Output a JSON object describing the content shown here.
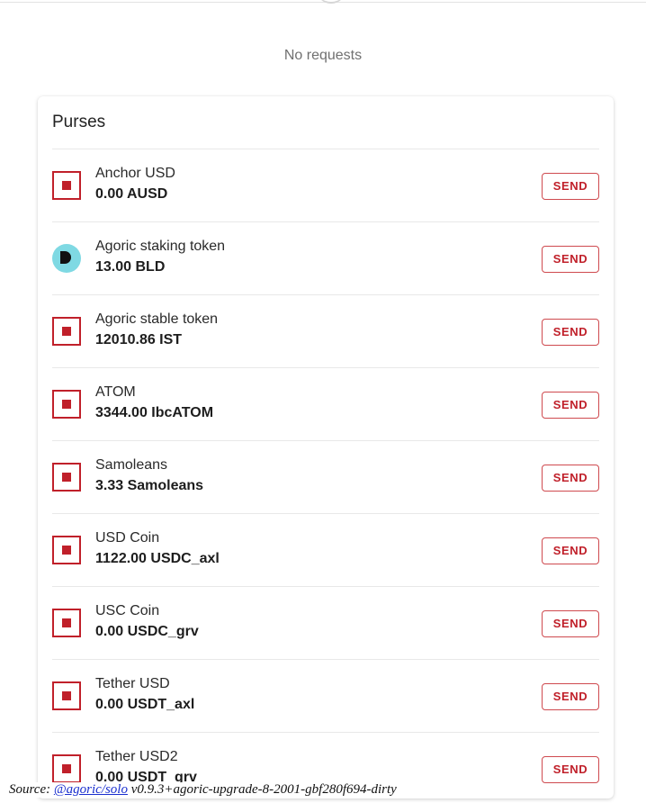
{
  "requests": {
    "empty_text": "No requests"
  },
  "purses": {
    "title": "Purses",
    "items": [
      {
        "name": "Anchor USD",
        "balance": "0.00 AUSD",
        "icon": "square-icon",
        "send_label": "SEND"
      },
      {
        "name": "Agoric staking token",
        "balance": "13.00 BLD",
        "icon": "bld-logo-icon",
        "send_label": "SEND"
      },
      {
        "name": "Agoric stable token",
        "balance": "12010.86 IST",
        "icon": "square-icon",
        "send_label": "SEND"
      },
      {
        "name": "ATOM",
        "balance": "3344.00 IbcATOM",
        "icon": "square-icon",
        "send_label": "SEND"
      },
      {
        "name": "Samoleans",
        "balance": "3.33 Samoleans",
        "icon": "square-icon",
        "send_label": "SEND"
      },
      {
        "name": "USD Coin",
        "balance": "1122.00 USDC_axl",
        "icon": "square-icon",
        "send_label": "SEND"
      },
      {
        "name": "USC Coin",
        "balance": "0.00 USDC_grv",
        "icon": "square-icon",
        "send_label": "SEND"
      },
      {
        "name": "Tether USD",
        "balance": "0.00 USDT_axl",
        "icon": "square-icon",
        "send_label": "SEND"
      },
      {
        "name": "Tether USD2",
        "balance": "0.00 USDT_grv",
        "icon": "square-icon",
        "send_label": "SEND"
      }
    ]
  },
  "footer": {
    "prefix": "Source: ",
    "link_text": "@agoric/solo",
    "version": " v0.9.3+agoric-upgrade-8-2001-gbf280f694-dirty"
  },
  "colors": {
    "accent": "#c0202a",
    "bld_logo_bg": "#7fd9e3",
    "link": "#1a2fcf"
  }
}
